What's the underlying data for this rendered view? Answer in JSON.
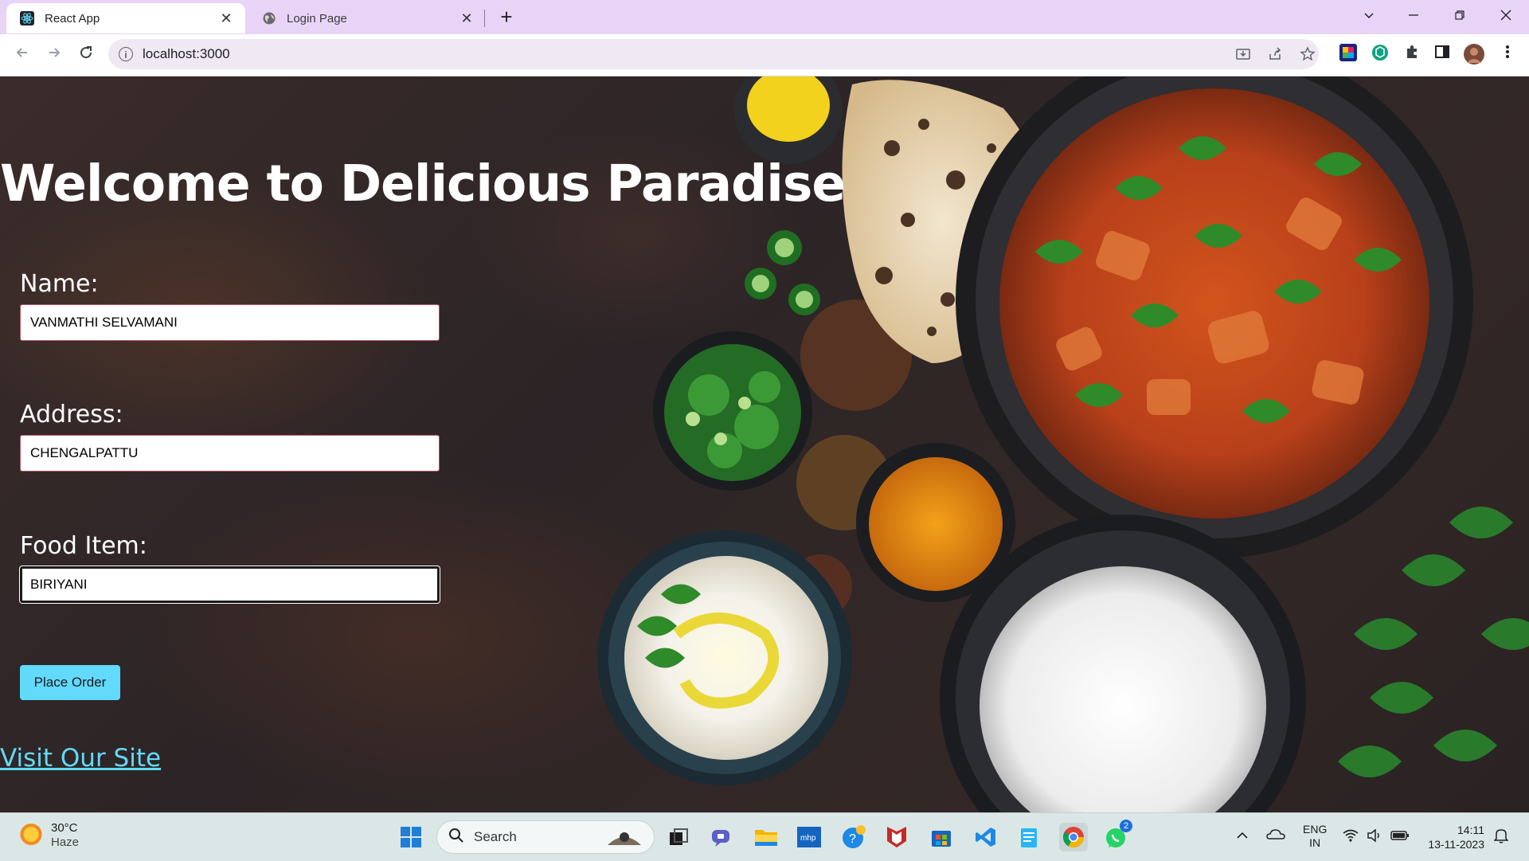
{
  "browser": {
    "tabs": [
      {
        "title": "React App",
        "active": true,
        "icon": "react-icon"
      },
      {
        "title": "Login Page",
        "active": false,
        "icon": "globe-icon"
      }
    ],
    "close_glyph": "✕",
    "new_tab_glyph": "+",
    "url": "localhost:3000"
  },
  "page": {
    "heading": "Welcome to Delicious Paradise",
    "form": {
      "name_label": "Name:",
      "name_value": "VANMATHI SELVAMANI",
      "address_label": "Address:",
      "address_value": "CHENGALPATTU",
      "food_label": "Food Item:",
      "food_value": "BIRIYANI",
      "submit_label": "Place Order"
    },
    "link_text": "Visit Our Site"
  },
  "taskbar": {
    "weather_temp": "30°C",
    "weather_condition": "Haze",
    "search_label": "Search",
    "whatsapp_badge": "2",
    "language": "ENG",
    "region": "IN",
    "time": "14:11",
    "date": "13-11-2023"
  },
  "colors": {
    "accent": "#61dafb",
    "tabbar_bg": "#e8d4f7"
  }
}
